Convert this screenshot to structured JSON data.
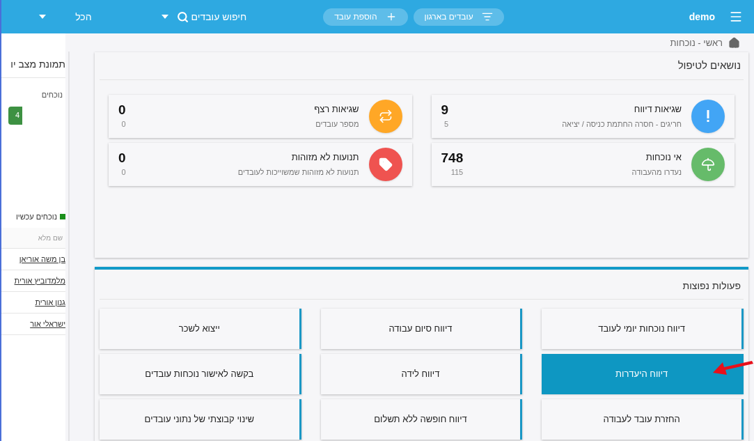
{
  "topbar": {
    "user": "demo",
    "buttons": [
      {
        "kind": "filter",
        "label": "עובדים בארגון"
      },
      {
        "kind": "add",
        "label": "הוספת עובד"
      }
    ],
    "search": {
      "label": "חיפוש עובדים"
    },
    "scope": {
      "label": "הכל"
    }
  },
  "breadcrumb": "ראשי - נוכחות",
  "side_panel": {
    "title": "תמונת מצב יו",
    "present_label": "נוכחים",
    "present_count": "4",
    "legend": "נוכחים עכשיו",
    "column": "שם מלא",
    "rows": [
      "בן משה אוריאן",
      "מלמדוביץ אורית",
      "גנון אורית",
      "ישראלי אור"
    ]
  },
  "issues": {
    "title": "נושאים לטיפול",
    "cards": [
      {
        "kind": "alert",
        "color": "#42a5f5",
        "title": "שגיאות דיווח",
        "subtitle": "חריגים - חסרה החתמת כניסה / יציאה",
        "value": "9",
        "secondary": "5"
      },
      {
        "kind": "sequence",
        "color": "#ffa726",
        "title": "שגיאות רצף",
        "subtitle": "מספר עובדים",
        "value": "0",
        "secondary": "0"
      },
      {
        "kind": "absence",
        "color": "#66bb6a",
        "title": "אי נוכחות",
        "subtitle": "נעדרו מהעבודה",
        "value": "748",
        "secondary": "115"
      },
      {
        "kind": "tag",
        "color": "#ef5350",
        "title": "תנועות לא מזוהות",
        "subtitle": "תנועות לא מזוהות שמשוייכות לעובדים",
        "value": "0",
        "secondary": "0"
      }
    ]
  },
  "actions": {
    "title": "פעולות נפוצות",
    "items": [
      {
        "label": "דיווח נוכחות יומי לעובד",
        "selected": false
      },
      {
        "label": "דיווח סיום עבודה",
        "selected": false
      },
      {
        "label": "ייצוא לשכר",
        "selected": false
      },
      {
        "label": "דיווח היעדרות",
        "selected": true
      },
      {
        "label": "דיווח לידה",
        "selected": false
      },
      {
        "label": "בקשה לאישור נוכחות עובדים",
        "selected": false
      },
      {
        "label": "החזרת עובד לעבודה",
        "selected": false
      },
      {
        "label": "דיווח חופשה ללא תשלום",
        "selected": false
      },
      {
        "label": "שינוי קבוצתי של נתוני עובדים",
        "selected": false
      }
    ]
  }
}
